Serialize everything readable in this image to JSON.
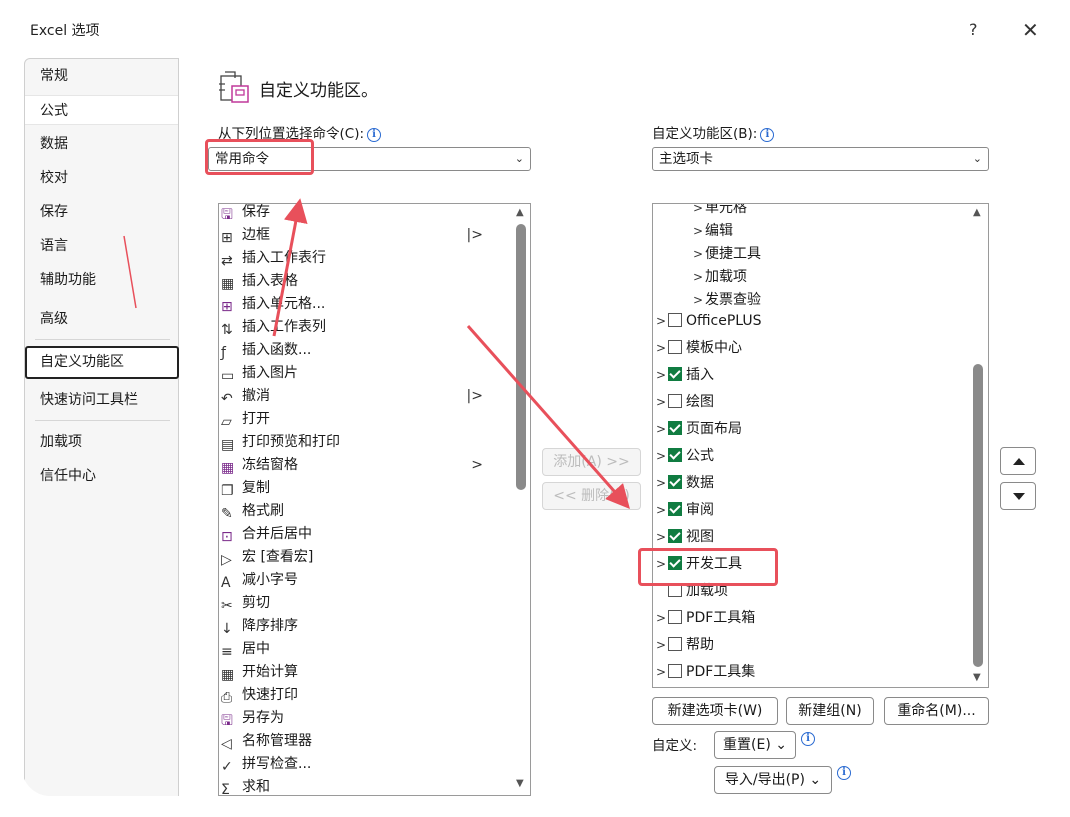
{
  "window": {
    "title": "Excel 选项",
    "help": "?",
    "close": "✕"
  },
  "nav": {
    "items": [
      "常规",
      "公式",
      "数据",
      "校对",
      "保存",
      "语言",
      "辅助功能",
      "高级",
      "自定义功能区",
      "快速访问工具栏",
      "加载项",
      "信任中心"
    ],
    "selected": "自定义功能区"
  },
  "header": {
    "title": "自定义功能区。"
  },
  "left": {
    "label": "从下列位置选择命令(C):",
    "select_value": "常用命令",
    "commands": [
      {
        "label": "保存",
        "icon": "save-icon",
        "sub": ""
      },
      {
        "label": "边框",
        "icon": "border-icon",
        "sub": "|>"
      },
      {
        "label": "插入工作表行",
        "icon": "insert-row-icon",
        "sub": ""
      },
      {
        "label": "插入表格",
        "icon": "table-icon",
        "sub": ""
      },
      {
        "label": "插入单元格...",
        "icon": "insert-cell-icon",
        "sub": ""
      },
      {
        "label": "插入工作表列",
        "icon": "insert-column-icon",
        "sub": ""
      },
      {
        "label": "插入函数...",
        "icon": "function-icon",
        "sub": ""
      },
      {
        "label": "插入图片",
        "icon": "picture-icon",
        "sub": ""
      },
      {
        "label": "撤消",
        "icon": "undo-icon",
        "sub": "|>"
      },
      {
        "label": "打开",
        "icon": "folder-icon",
        "sub": ""
      },
      {
        "label": "打印预览和打印",
        "icon": "print-preview-icon",
        "sub": ""
      },
      {
        "label": "冻结窗格",
        "icon": "freeze-icon",
        "sub": ">"
      },
      {
        "label": "复制",
        "icon": "copy-icon",
        "sub": ""
      },
      {
        "label": "格式刷",
        "icon": "format-painter-icon",
        "sub": ""
      },
      {
        "label": "合并后居中",
        "icon": "merge-icon",
        "sub": ""
      },
      {
        "label": "宏 [查看宏]",
        "icon": "macro-icon",
        "sub": ""
      },
      {
        "label": "减小字号",
        "icon": "font-decrease-icon",
        "sub": ""
      },
      {
        "label": "剪切",
        "icon": "cut-icon",
        "sub": ""
      },
      {
        "label": "降序排序",
        "icon": "sort-desc-icon",
        "sub": ""
      },
      {
        "label": "居中",
        "icon": "center-icon",
        "sub": ""
      },
      {
        "label": "开始计算",
        "icon": "calculate-icon",
        "sub": ""
      },
      {
        "label": "快速打印",
        "icon": "quick-print-icon",
        "sub": ""
      },
      {
        "label": "另存为",
        "icon": "save-as-icon",
        "sub": ""
      },
      {
        "label": "名称管理器",
        "icon": "name-manager-icon",
        "sub": ""
      },
      {
        "label": "拼写检查...",
        "icon": "spelling-icon",
        "sub": ""
      },
      {
        "label": "求和",
        "icon": "sum-icon",
        "sub": ""
      }
    ]
  },
  "middle": {
    "add_label": "添加(A) >>",
    "remove_label": "<< 删除(R)"
  },
  "right": {
    "label": "自定义功能区(B):",
    "select_value": "主选项卡",
    "subitems": [
      "单元格",
      "编辑",
      "便捷工具",
      "加载项",
      "发票查验"
    ],
    "tabs": [
      {
        "label": "OfficePLUS",
        "checked": false,
        "expand": true
      },
      {
        "label": "模板中心",
        "checked": false,
        "expand": true
      },
      {
        "label": "插入",
        "checked": true,
        "expand": true
      },
      {
        "label": "绘图",
        "checked": false,
        "expand": true
      },
      {
        "label": "页面布局",
        "checked": true,
        "expand": true
      },
      {
        "label": "公式",
        "checked": true,
        "expand": true
      },
      {
        "label": "数据",
        "checked": true,
        "expand": true
      },
      {
        "label": "审阅",
        "checked": true,
        "expand": true
      },
      {
        "label": "视图",
        "checked": true,
        "expand": true
      },
      {
        "label": "开发工具",
        "checked": true,
        "expand": true
      },
      {
        "label": "加载项",
        "checked": false,
        "expand": false
      },
      {
        "label": "PDF工具箱",
        "checked": false,
        "expand": true
      },
      {
        "label": "帮助",
        "checked": false,
        "expand": true
      },
      {
        "label": "PDF工具集",
        "checked": false,
        "expand": true
      }
    ],
    "new_tab": "新建选项卡(W)",
    "new_group": "新建组(N)",
    "rename": "重命名(M)...",
    "custom_label": "自定义:",
    "reset": "重置(E) ⌄",
    "import_export": "导入/导出(P) ⌄"
  },
  "colors": {
    "highlight": "#e8505b",
    "check": "#107c41",
    "info": "#2a6ad1"
  }
}
